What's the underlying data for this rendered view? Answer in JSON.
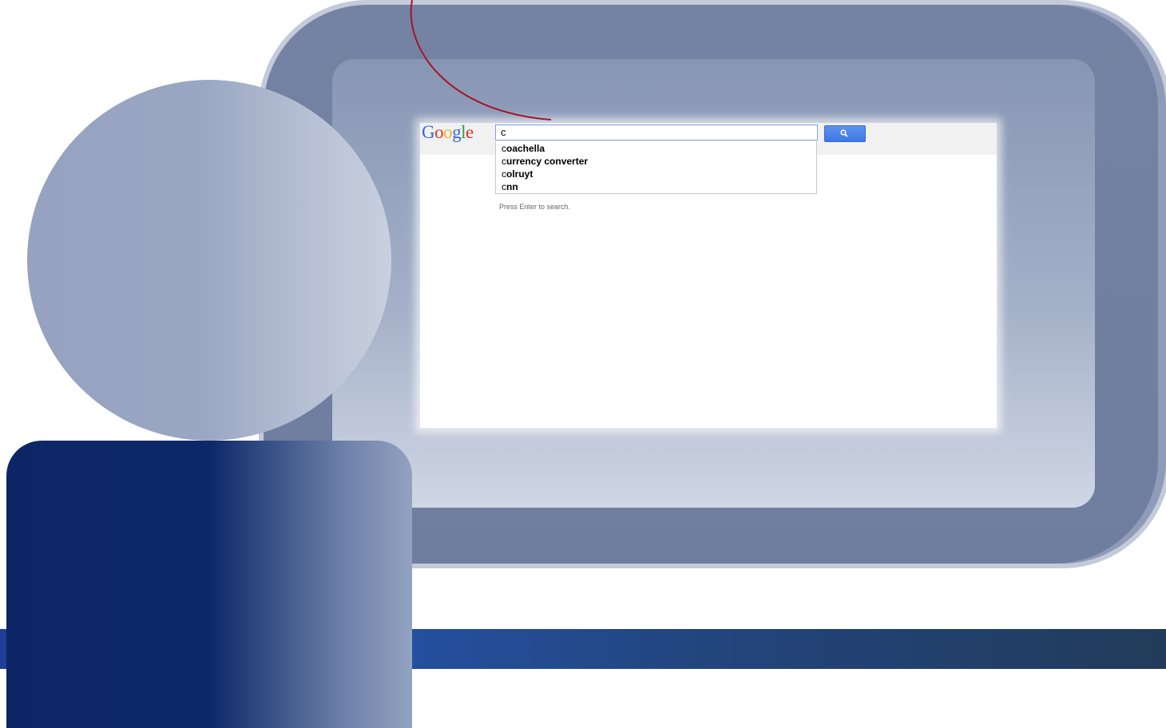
{
  "google_logo": {
    "letters": [
      "G",
      "o",
      "o",
      "g",
      "l",
      "e"
    ]
  },
  "search": {
    "query": "c",
    "button_icon": "magnifier-icon"
  },
  "suggestions": [
    {
      "typed": "c",
      "rest": "oachella"
    },
    {
      "typed": "c",
      "rest": "urrency converter"
    },
    {
      "typed": "c",
      "rest": "olruyt"
    },
    {
      "typed": "c",
      "rest": "nn"
    }
  ],
  "hint": "Press Enter to search.",
  "colors": {
    "monitor_frame": "#7482a3",
    "person_body": "#0c2565",
    "annotation_curve": "#a3172b",
    "search_button": "#4a84ec"
  }
}
